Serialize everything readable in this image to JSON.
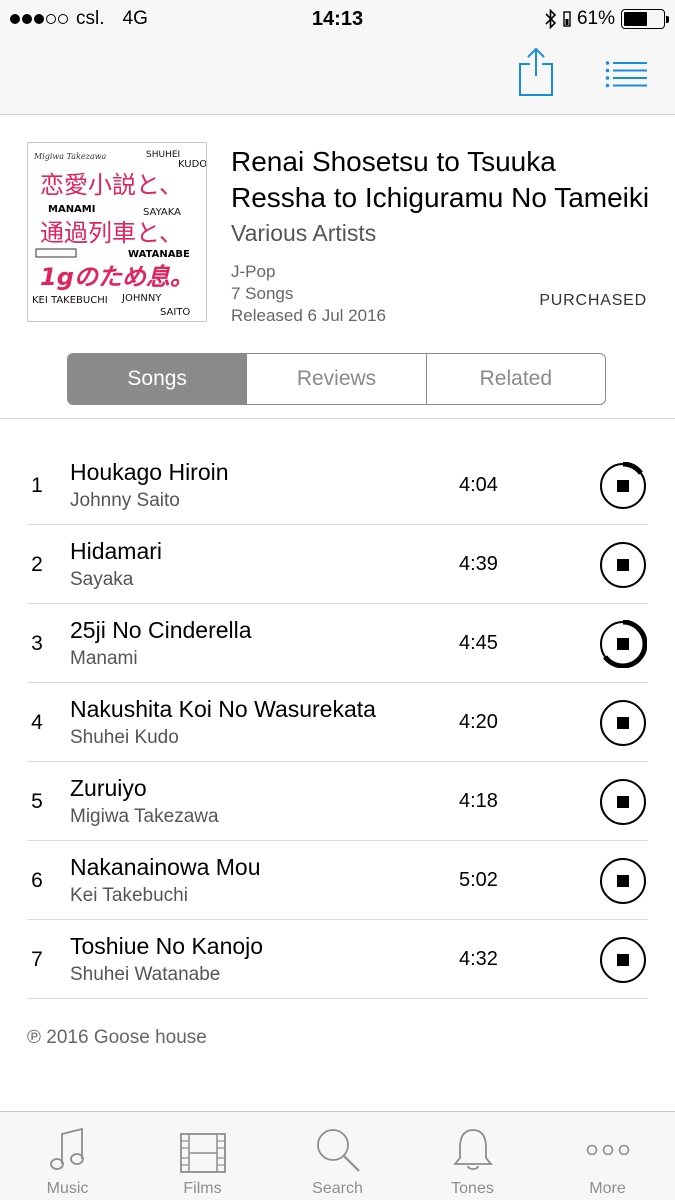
{
  "status_bar": {
    "carrier": "csl.",
    "network": "4G",
    "time": "14:13",
    "battery_percent": "61%",
    "battery_level": 0.61,
    "signal_bars": 3,
    "signal_total": 5
  },
  "nav": {
    "accent_color": "#1a8ce0"
  },
  "album": {
    "title": "Renai Shosetsu to Tsuuka Ressha to Ichiguramu No Tameiki",
    "artist": "Various Artists",
    "genre": "J-Pop",
    "song_count": "7 Songs",
    "released": "Released 6 Jul 2016",
    "status": "PURCHASED",
    "art": {
      "names_top": "Migiwa Takezawa",
      "line1": "恋愛小説と、",
      "line2": "通過列車と、",
      "line3": "1gのため息。",
      "name_shuhei": "SHUHEI",
      "name_kudo": "KUDO",
      "name_manami": "MANAMI",
      "name_sayaka": "SAYAKA",
      "name_watanabe": "WATANABE",
      "name_kei": "KEI TAKEBUCHI",
      "name_johnny": "JOHNNY",
      "name_saito": "SAITO"
    }
  },
  "segments": [
    {
      "label": "Songs",
      "active": true
    },
    {
      "label": "Reviews",
      "active": false
    },
    {
      "label": "Related",
      "active": false
    }
  ],
  "tracks": [
    {
      "num": "1",
      "title": "Houkago Hiroin",
      "artist": "Johnny Saito",
      "duration": "4:04",
      "progress": 0.15
    },
    {
      "num": "2",
      "title": "Hidamari",
      "artist": "Sayaka",
      "duration": "4:39",
      "progress": 0
    },
    {
      "num": "3",
      "title": "25ji No Cinderella",
      "artist": "Manami",
      "duration": "4:45",
      "progress": 0.65
    },
    {
      "num": "4",
      "title": "Nakushita Koi No Wasurekata",
      "artist": "Shuhei Kudo",
      "duration": "4:20",
      "progress": 0
    },
    {
      "num": "5",
      "title": "Zuruiyo",
      "artist": "Migiwa Takezawa",
      "duration": "4:18",
      "progress": 0
    },
    {
      "num": "6",
      "title": "Nakanainowa Mou",
      "artist": "Kei Takebuchi",
      "duration": "5:02",
      "progress": 0
    },
    {
      "num": "7",
      "title": "Toshiue No Kanojo",
      "artist": "Shuhei Watanabe",
      "duration": "4:32",
      "progress": 0
    }
  ],
  "copyright": "℗ 2016 Goose house",
  "tab_bar": [
    {
      "label": "Music",
      "icon": "music-note-icon"
    },
    {
      "label": "Films",
      "icon": "film-icon"
    },
    {
      "label": "Search",
      "icon": "search-icon"
    },
    {
      "label": "Tones",
      "icon": "bell-icon"
    },
    {
      "label": "More",
      "icon": "more-dots-icon"
    }
  ]
}
